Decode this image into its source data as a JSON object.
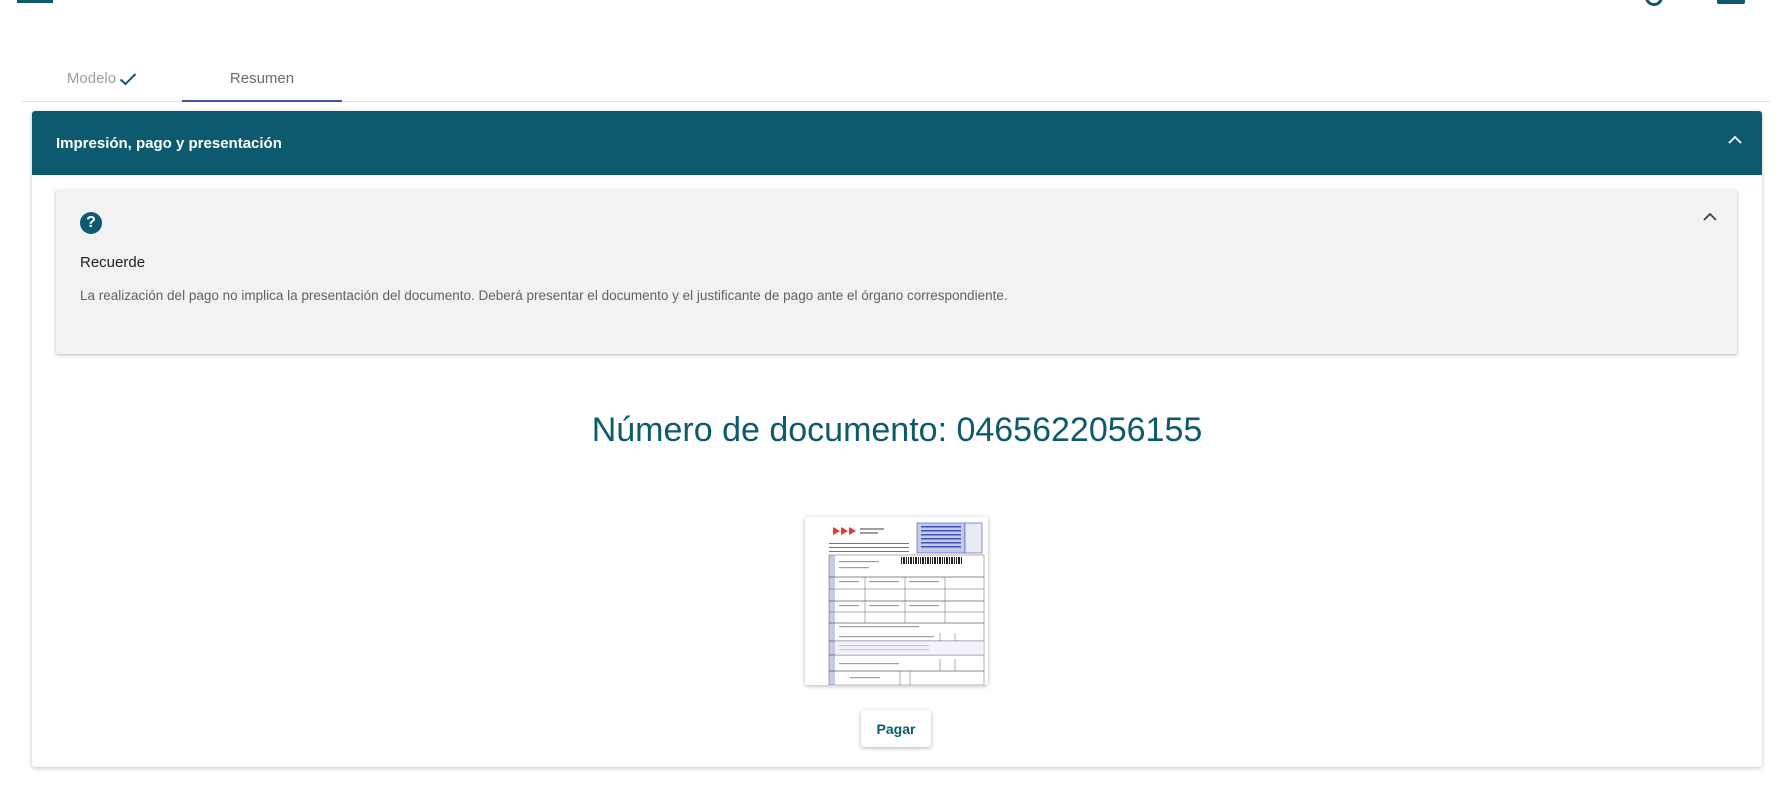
{
  "tabs": [
    {
      "label": "Modelo",
      "state": "completed"
    },
    {
      "label": "Resumen",
      "state": "active"
    }
  ],
  "panel": {
    "title": "Impresión, pago y presentación",
    "notice": {
      "title": "Recuerde",
      "text": "La realización del pago no implica la presentación del documento. Deberá presentar el documento y el justificante de pago ante el órgano correspondiente."
    },
    "document_number": "Número de documento: 0465622056155",
    "pay_label": "Pagar"
  },
  "icons": {
    "tab_done": "check-icon",
    "help": "help-circle-icon",
    "collapse": "chevron-up-icon"
  },
  "colors": {
    "primary": "#0d5a6e",
    "tab_indicator": "#3f51b5",
    "notice_bg": "#f2f2f2"
  }
}
